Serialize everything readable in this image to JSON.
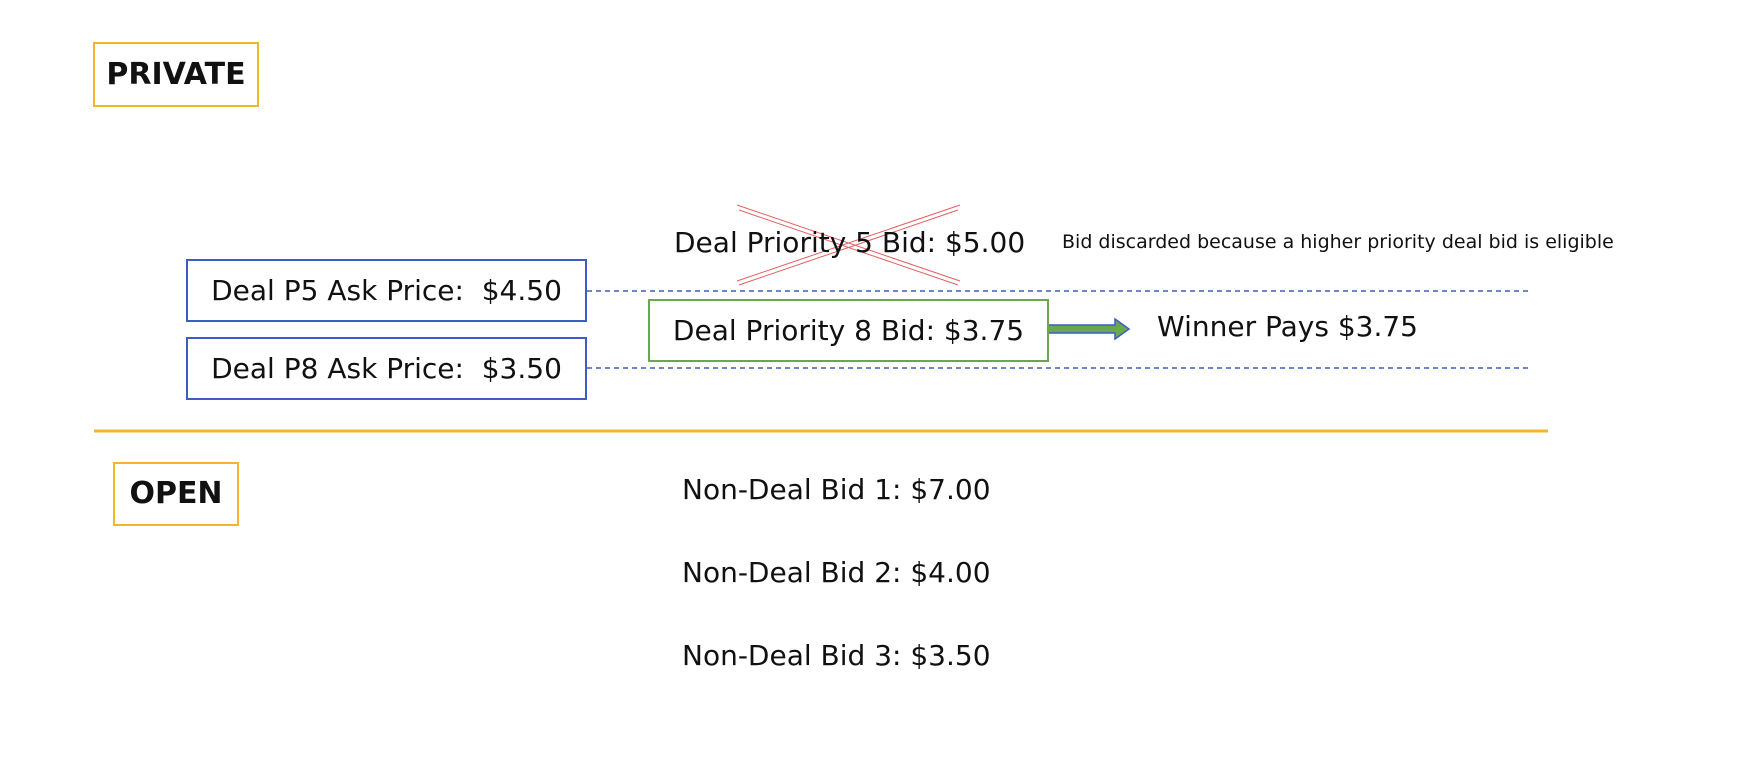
{
  "sections": {
    "private_label": "PRIVATE",
    "open_label": "OPEN"
  },
  "private": {
    "asks": [
      {
        "label": "Deal P5 Ask Price:  $4.50"
      },
      {
        "label": "Deal P8 Ask Price:  $3.50"
      }
    ],
    "discarded_bid": "Deal Priority 5 Bid: $5.00",
    "discard_note": "Bid discarded because a higher priority deal bid is eligible",
    "winning_bid": "Deal Priority 8 Bid: $3.75",
    "winner_text": "Winner Pays $3.75"
  },
  "open": {
    "bids": [
      {
        "label": "Non-Deal Bid 1: $7.00"
      },
      {
        "label": "Non-Deal Bid 2: $4.00"
      },
      {
        "label": "Non-Deal Bid 3: $3.50"
      }
    ]
  },
  "colors": {
    "section_border": "#f2b52c",
    "ask_border": "#3a5fc0",
    "winning_border": "#6aa84f",
    "strike": "#e06060",
    "dashed_line": "#3a5fc0",
    "divider": "#f2b52c"
  }
}
